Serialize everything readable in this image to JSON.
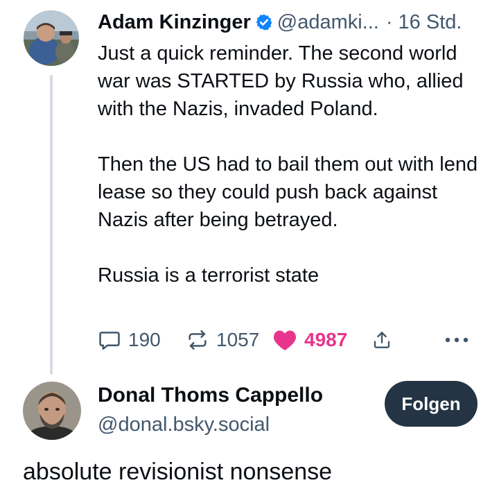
{
  "parent_post": {
    "author_name": "Adam Kinzinger",
    "handle": "@adamki...",
    "separator": "·",
    "timestamp": "16 Std.",
    "paragraphs": [
      "Just a quick reminder. The second world war was STARTED by Russia who, allied with the Nazis, invaded Poland.",
      "Then the US had to bail them out with lend lease so they could push back against Nazis after being betrayed.",
      "Russia is a terrorist state"
    ],
    "actions": {
      "reply_count": "190",
      "repost_count": "1057",
      "like_count": "4987",
      "liked": true
    },
    "icons": {
      "verified": "verified-badge-icon",
      "reply": "speech-bubble-icon",
      "repost": "repost-arrows-icon",
      "like": "heart-icon",
      "share": "share-upload-icon",
      "more": "more-dots-icon"
    }
  },
  "reply_post": {
    "author_name": "Donal Thoms Cappello",
    "handle": "@donal.bsky.social",
    "follow_label": "Folgen",
    "text": "absolute revisionist nonsense"
  },
  "colors": {
    "text": "#0b0f14",
    "muted": "#42576c",
    "verified": "#1083fe",
    "like": "#e8358c",
    "thread_line": "#d5dbe3",
    "follow_bg": "#243444"
  }
}
